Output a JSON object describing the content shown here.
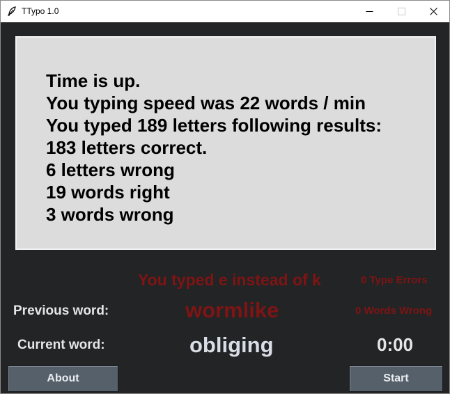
{
  "window": {
    "title": "TTypo 1.0",
    "icon": "feather-icon"
  },
  "results": {
    "lines": [
      "Time is up.",
      "You typing speed was 22 words / min",
      "You typed 189 letters following results:",
      "183 letters correct.",
      "6 letters wrong",
      "19 words right",
      "3 words wrong"
    ]
  },
  "status": {
    "error_message": "You typed e instead of k",
    "type_errors": "0 Type Errors",
    "words_wrong": "0 Words Wrong"
  },
  "words": {
    "previous_label": "Previous word:",
    "previous_value": "wormlike",
    "current_label": "Current word:",
    "current_value": "obliging"
  },
  "timer": "0:00",
  "buttons": {
    "about": "About",
    "start": "Start"
  },
  "colors": {
    "background": "#222426",
    "panel": "#dcdcdc",
    "error": "#7f1414",
    "button": "#56606a"
  }
}
